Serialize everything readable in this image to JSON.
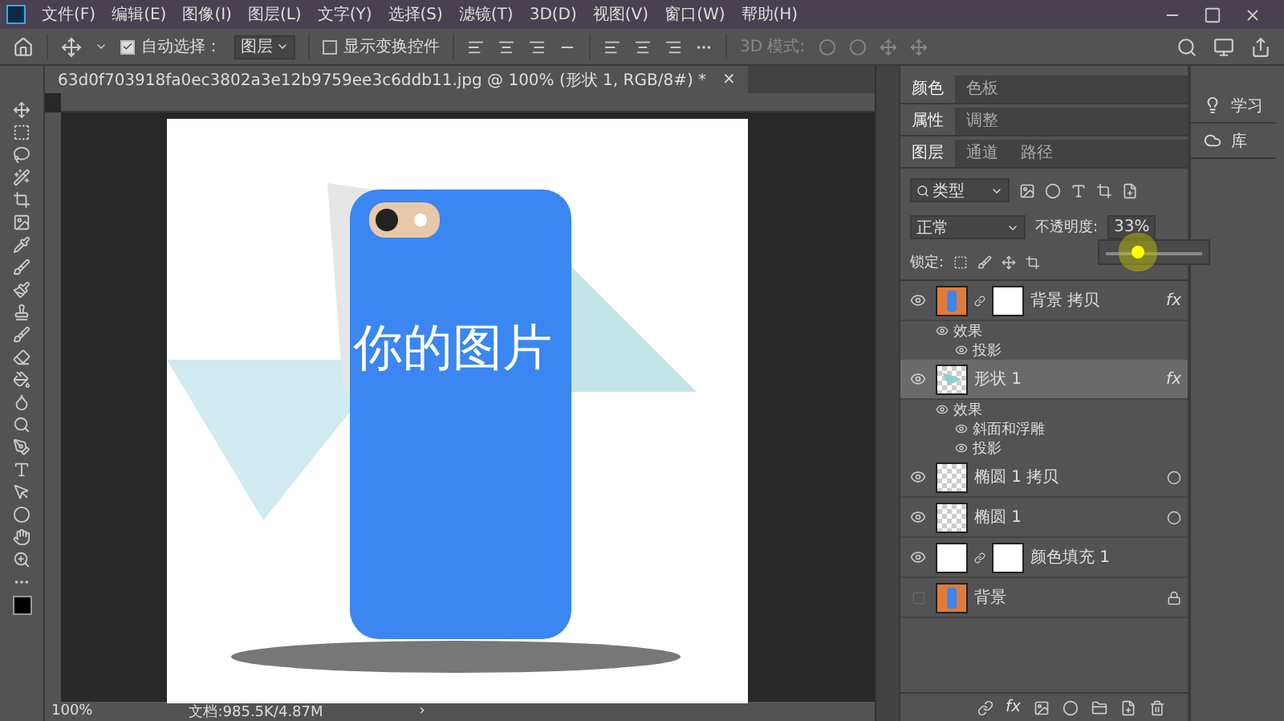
{
  "menu": [
    "文件(F)",
    "编辑(E)",
    "图像(I)",
    "图层(L)",
    "文字(Y)",
    "选择(S)",
    "滤镜(T)",
    "3D(D)",
    "视图(V)",
    "窗口(W)",
    "帮助(H)"
  ],
  "options_bar": {
    "auto_select": {
      "label": "自动选择：",
      "checked": true
    },
    "target": "图层",
    "show_transform": {
      "label": "显示变换控件",
      "checked": false
    },
    "mode_3d": "3D 模式:"
  },
  "document_tab": {
    "title": "63d0f703918fa0ec3802a3e12b9759ee3c6ddb11.jpg @ 100% (形状 1, RGB/8#) *",
    "close": "×"
  },
  "canvas": {
    "overlay_text": "你的图片"
  },
  "status_bar": {
    "zoom": "100%",
    "doc_size": "文档:985.5K/4.87M",
    "arrow": "›"
  },
  "panel_groups": [
    {
      "tabs": [
        {
          "label": "颜色",
          "selected": true
        },
        {
          "label": "色板",
          "selected": false
        }
      ]
    },
    {
      "tabs": [
        {
          "label": "属性",
          "selected": true
        },
        {
          "label": "调整",
          "selected": false
        }
      ]
    },
    {
      "tabs": [
        {
          "label": "图层",
          "selected": true
        },
        {
          "label": "通道",
          "selected": false
        },
        {
          "label": "路径",
          "selected": false
        }
      ]
    }
  ],
  "layers_panel": {
    "filter": "类型",
    "blend_mode": "正常",
    "opacity_label": "不透明度:",
    "opacity": "33%",
    "opacity_slider": {
      "level": 0.33
    },
    "lock_label": "锁定:",
    "layers": [
      {
        "name": "背景 拷贝",
        "kind": "photo",
        "mask": true,
        "fx": "fx",
        "visible": true,
        "locked": false,
        "selected": false,
        "effects": [
          {
            "label": "效果",
            "children": [
              {
                "label": "投影"
              }
            ]
          }
        ]
      },
      {
        "name": "形状 1",
        "kind": "shape",
        "mask": false,
        "fx": "fx",
        "visible": true,
        "locked": false,
        "selected": true,
        "effects": [
          {
            "label": "效果",
            "children": [
              {
                "label": "斜面和浮雕"
              },
              {
                "label": "投影"
              }
            ]
          }
        ]
      },
      {
        "name": "椭圆 1 拷贝",
        "kind": "smart",
        "mask": false,
        "visible": true,
        "locked": false,
        "selected": false
      },
      {
        "name": "椭圆 1",
        "kind": "smart",
        "mask": false,
        "visible": true,
        "locked": false,
        "selected": false
      },
      {
        "name": "颜色填充 1",
        "kind": "fill",
        "mask": true,
        "visible": true,
        "locked": false,
        "selected": false
      },
      {
        "name": "背景",
        "kind": "photo",
        "mask": false,
        "visible": false,
        "locked": true,
        "selected": false
      }
    ],
    "add_style": "fx"
  },
  "side_panel": [
    {
      "label": "学习",
      "kind": "learn"
    },
    {
      "label": "库",
      "kind": "library"
    }
  ]
}
